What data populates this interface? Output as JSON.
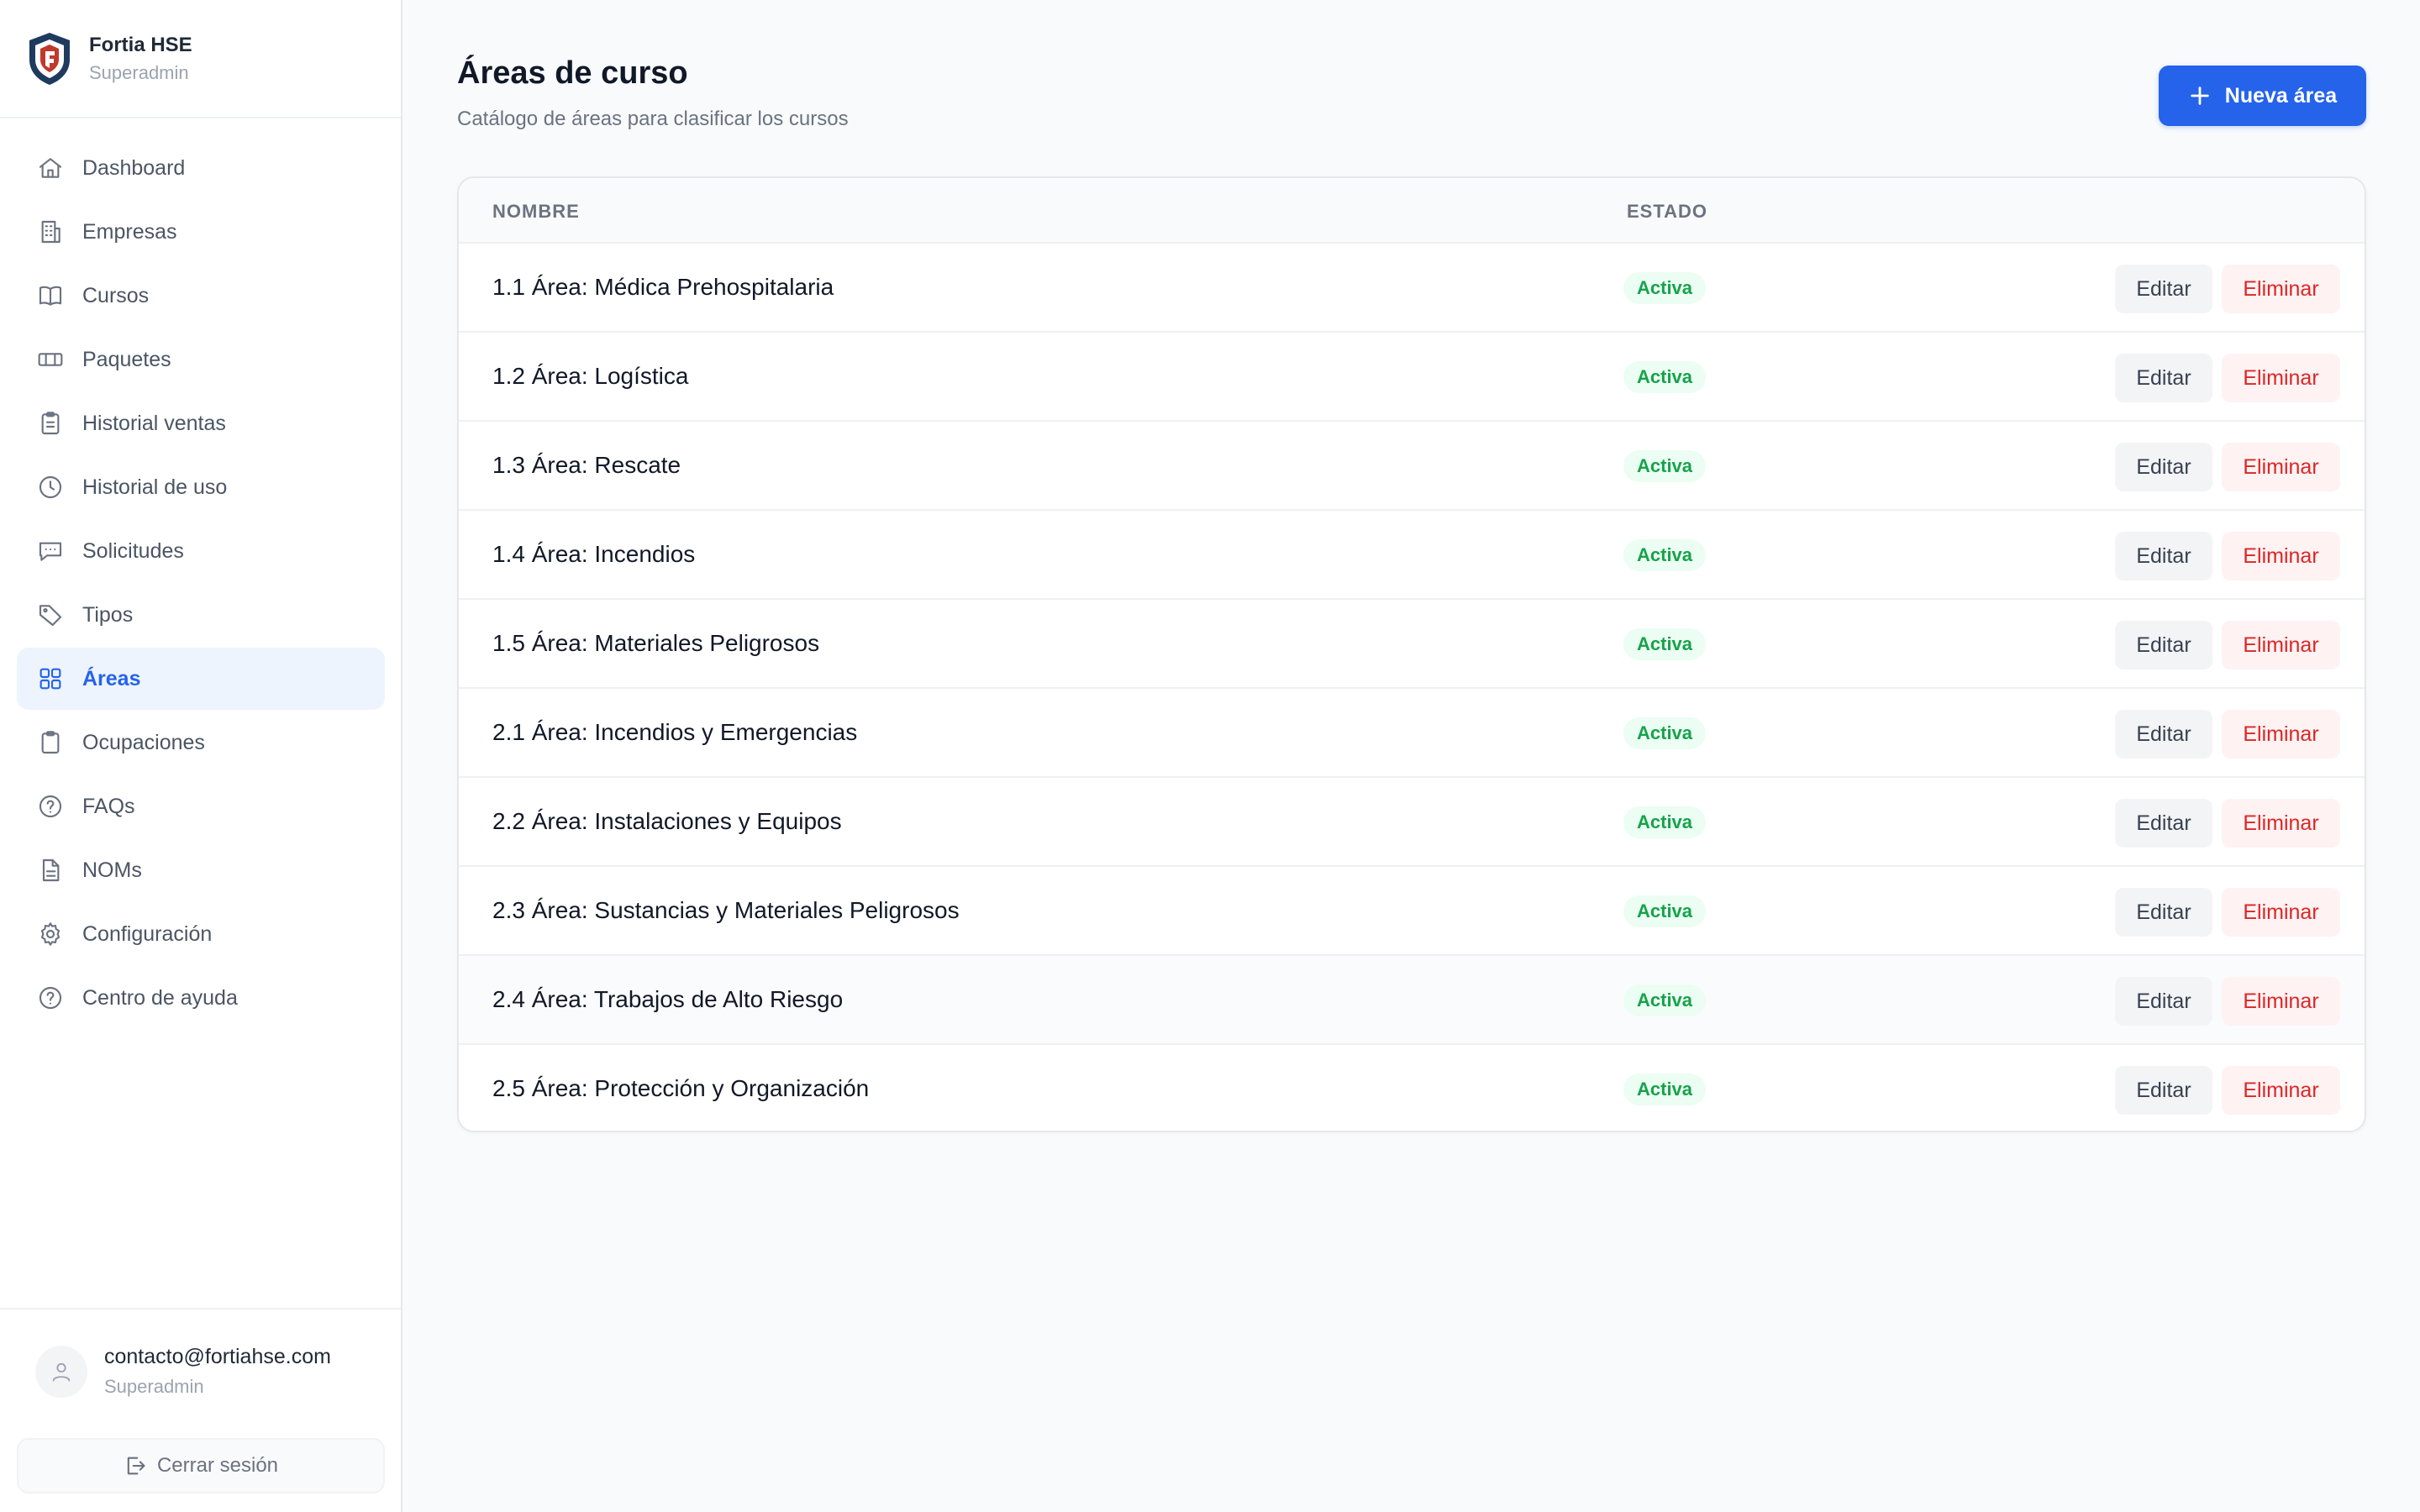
{
  "brand": {
    "name": "Fortia HSE",
    "role": "Superadmin"
  },
  "sidebar": {
    "items": [
      {
        "label": "Dashboard",
        "icon": "home-icon"
      },
      {
        "label": "Empresas",
        "icon": "building-icon"
      },
      {
        "label": "Cursos",
        "icon": "book-icon"
      },
      {
        "label": "Paquetes",
        "icon": "package-icon"
      },
      {
        "label": "Historial ventas",
        "icon": "clipboard-icon"
      },
      {
        "label": "Historial de uso",
        "icon": "clock-icon"
      },
      {
        "label": "Solicitudes",
        "icon": "message-icon"
      },
      {
        "label": "Tipos",
        "icon": "tag-icon"
      },
      {
        "label": "Áreas",
        "icon": "grid-icon",
        "active": true
      },
      {
        "label": "Ocupaciones",
        "icon": "clipboard-icon"
      },
      {
        "label": "FAQs",
        "icon": "help-icon"
      },
      {
        "label": "NOMs",
        "icon": "document-icon"
      },
      {
        "label": "Configuración",
        "icon": "gear-icon"
      },
      {
        "label": "Centro de ayuda",
        "icon": "help-icon"
      }
    ]
  },
  "user": {
    "email": "contacto@fortiahse.com",
    "role": "Superadmin",
    "logout_label": "Cerrar sesión"
  },
  "header": {
    "title": "Áreas de curso",
    "subtitle": "Catálogo de áreas para clasificar los cursos",
    "new_button_label": "Nueva área"
  },
  "table": {
    "columns": [
      "NOMBRE",
      "ESTADO"
    ],
    "edit_label": "Editar",
    "delete_label": "Eliminar",
    "rows": [
      {
        "name": "1.1 Área: Médica Prehospitalaria",
        "status": "Activa"
      },
      {
        "name": "1.2 Área: Logística",
        "status": "Activa"
      },
      {
        "name": "1.3 Área: Rescate",
        "status": "Activa"
      },
      {
        "name": "1.4 Área: Incendios",
        "status": "Activa"
      },
      {
        "name": "1.5 Área: Materiales Peligrosos",
        "status": "Activa"
      },
      {
        "name": "2.1 Área: Incendios y Emergencias",
        "status": "Activa"
      },
      {
        "name": "2.2 Área: Instalaciones y Equipos",
        "status": "Activa"
      },
      {
        "name": "2.3 Área: Sustancias y Materiales Peligrosos",
        "status": "Activa"
      },
      {
        "name": "2.4 Área: Trabajos de Alto Riesgo",
        "status": "Activa"
      },
      {
        "name": "2.5 Área: Protección y Organización",
        "status": "Activa"
      }
    ]
  },
  "colors": {
    "accent": "#2563eb",
    "success": "#16a34a",
    "danger": "#dc2626"
  }
}
